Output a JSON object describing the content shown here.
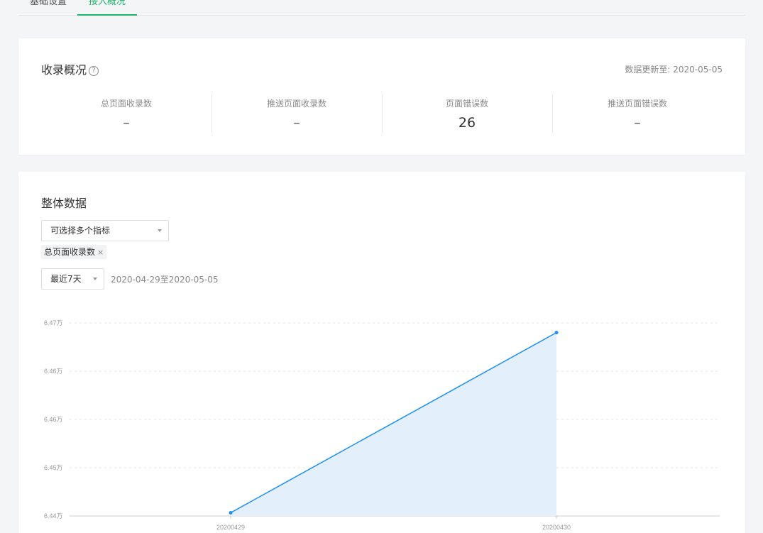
{
  "tabs": [
    {
      "label": "基础设置"
    },
    {
      "label": "接入概况"
    }
  ],
  "overview": {
    "title": "收录概况",
    "help_icon": "?",
    "update_text": "数据更新至: 2020-05-05",
    "stats": [
      {
        "label": "总页面收录数",
        "value": "–"
      },
      {
        "label": "推送页面收录数",
        "value": "–"
      },
      {
        "label": "页面错误数",
        "value": "26"
      },
      {
        "label": "推送页面错误数",
        "value": "–"
      }
    ]
  },
  "overall": {
    "title": "整体数据",
    "metric_select_placeholder": "可选择多个指标",
    "selected_tag": "总页面收录数",
    "tag_close": "×",
    "range_select": "最近7天",
    "date_range": "2020-04-29至2020-05-05"
  },
  "colors": {
    "accent": "#1fb36b",
    "line": "#1e90f0",
    "area": "#e3f0fc"
  },
  "chart_data": {
    "type": "area",
    "categories": [
      "20200429",
      "20200430"
    ],
    "values": [
      64405,
      64685
    ],
    "y_ticks": [
      "6.44万",
      "6.45万",
      "6.46万",
      "6.46万",
      "6.47万"
    ],
    "y_tick_values": [
      64400,
      64500,
      64600,
      64600,
      64700
    ],
    "ylim": [
      64400,
      64700
    ],
    "grid": true
  }
}
